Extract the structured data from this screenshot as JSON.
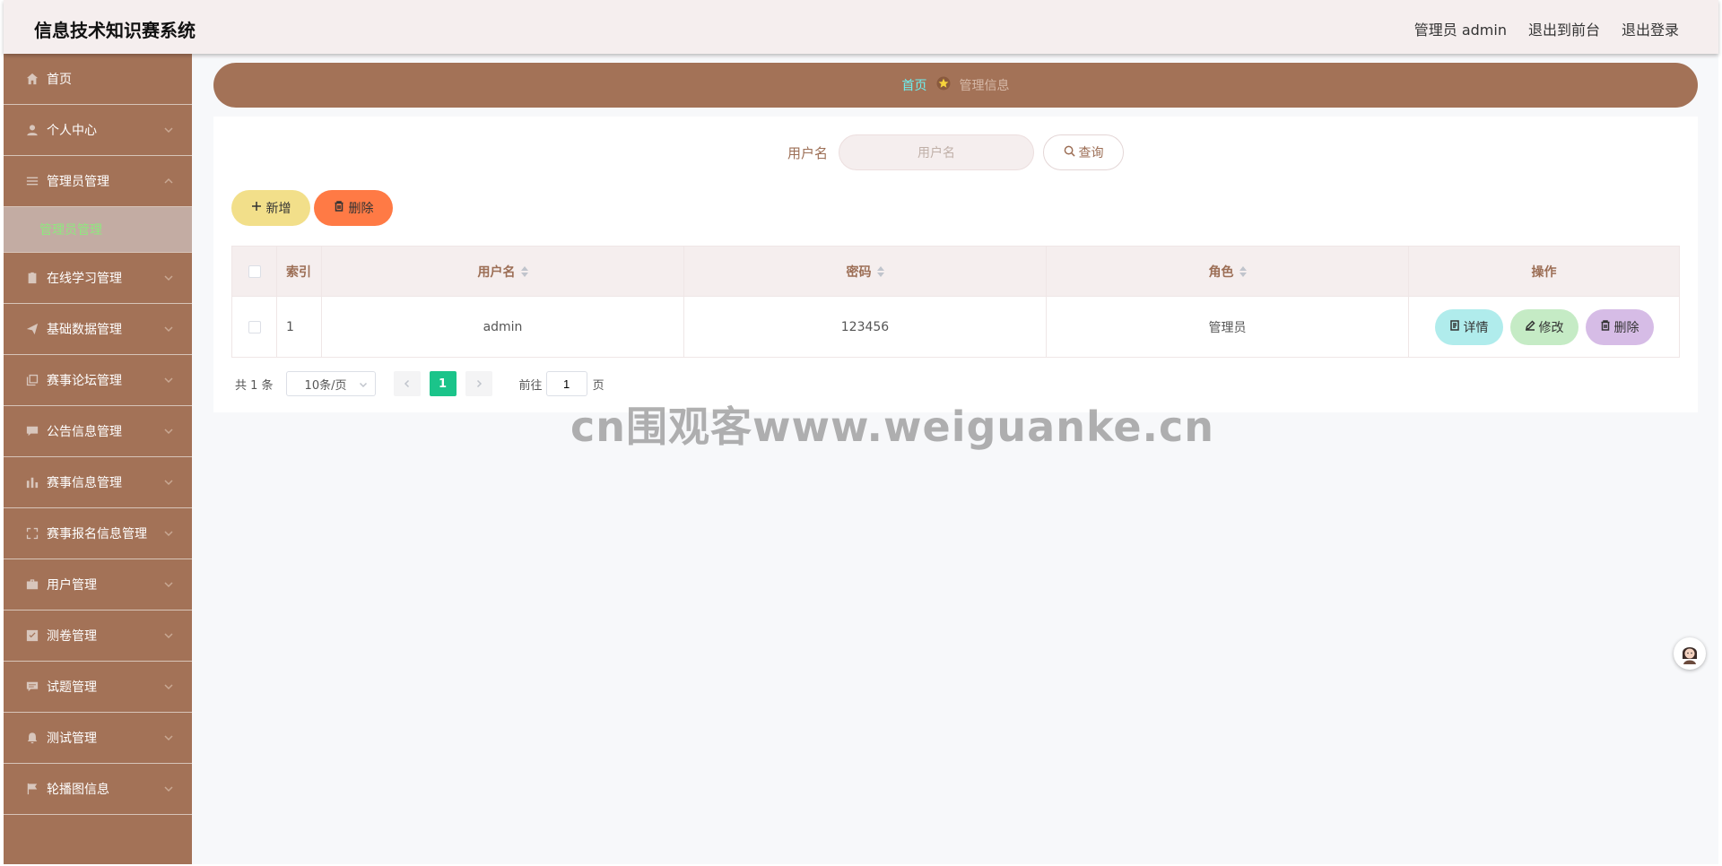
{
  "header": {
    "title": "信息技术知识赛系统",
    "user_label": "管理员 admin",
    "back_to_front": "退出到前台",
    "logout": "退出登录"
  },
  "sidebar": {
    "items": [
      {
        "label": "首页",
        "icon": "home-icon"
      },
      {
        "label": "个人中心",
        "icon": "user-icon"
      },
      {
        "label": "管理员管理",
        "icon": "list-icon",
        "expanded": true
      },
      {
        "label": "在线学习管理",
        "icon": "clipboard-icon"
      },
      {
        "label": "基础数据管理",
        "icon": "send-icon"
      },
      {
        "label": "赛事论坛管理",
        "icon": "copy-icon"
      },
      {
        "label": "公告信息管理",
        "icon": "message-icon"
      },
      {
        "label": "赛事信息管理",
        "icon": "chart-icon"
      },
      {
        "label": "赛事报名信息管理",
        "icon": "fullscreen-icon"
      },
      {
        "label": "用户管理",
        "icon": "briefcase-icon"
      },
      {
        "label": "测卷管理",
        "icon": "check-icon"
      },
      {
        "label": "试题管理",
        "icon": "chat-icon"
      },
      {
        "label": "测试管理",
        "icon": "bell-off-icon"
      },
      {
        "label": "轮播图信息",
        "icon": "flag-icon"
      }
    ],
    "sub_item": "管理员管理"
  },
  "breadcrumb": {
    "home": "首页",
    "current": "管理信息"
  },
  "search": {
    "label": "用户名",
    "placeholder": "用户名",
    "value": "",
    "button": "查询"
  },
  "actions": {
    "add": "新增",
    "delete": "删除"
  },
  "table": {
    "headers": {
      "index": "索引",
      "username": "用户名",
      "password": "密码",
      "role": "角色",
      "ops": "操作"
    },
    "rows": [
      {
        "index": "1",
        "username": "admin",
        "password": "123456",
        "role": "管理员"
      }
    ],
    "op_labels": {
      "detail": "详情",
      "edit": "修改",
      "delete": "删除"
    }
  },
  "pagination": {
    "total": "共 1 条",
    "page_size": "10条/页",
    "current_page": "1",
    "goto_prefix": "前往",
    "goto_value": "1",
    "goto_suffix": "页"
  },
  "watermark": "cn围观客www.weiguanke.cn",
  "colors": {
    "sidebar": "#a37257",
    "header": "#f5eeee",
    "accent_green": "#1bc48a",
    "breadcrumb_home": "#6cf0f0"
  }
}
